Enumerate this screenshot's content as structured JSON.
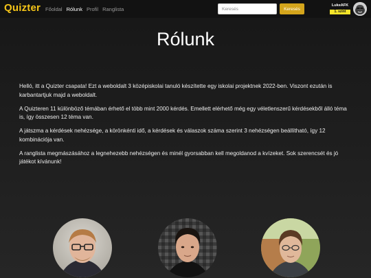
{
  "navbar": {
    "brand": "Quizter",
    "links": [
      {
        "label": "Főoldal",
        "active": false
      },
      {
        "label": "Rólunk",
        "active": true
      },
      {
        "label": "Profil",
        "active": false
      },
      {
        "label": "Ranglista",
        "active": false
      }
    ],
    "search": {
      "placeholder": "Keresés",
      "value": "",
      "button_label": "Keresés"
    },
    "user": {
      "name": "LukeAFK",
      "badge": "1. szint"
    }
  },
  "page": {
    "title": "Rólunk",
    "paragraphs": [
      "Helló, itt a Quizter csapata! Ezt a weboldalt 3 középiskolai tanuló készítette egy iskolai projektnek 2022-ben. Viszont ezután is karbantartjuk majd a weboldalt.",
      "A Quizteren 11 különböző témában érhető el több mint 2000 kérdés. Emellett elérhető még egy véletlenszerű kérdésekből álló téma is, így összesen 12 téma van.",
      "A játszma a kérdések nehézsége, a körönkénti idő, a kérdések és válaszok száma szerint 3 nehézségen beállítható, így 12 kombinációja van.",
      "A ranglista megmászásához a legnehezebb nehézségen és minél gyorsabban kell megoldanod a kvízeket. Sok szerencsét és jó játékot kívánunk!"
    ]
  },
  "colors": {
    "brand": "#f5c518",
    "search_button": "#d4a51c",
    "badge": "#f5e52a"
  },
  "team_photos": [
    "member-1-photo",
    "member-2-photo",
    "member-3-photo"
  ]
}
